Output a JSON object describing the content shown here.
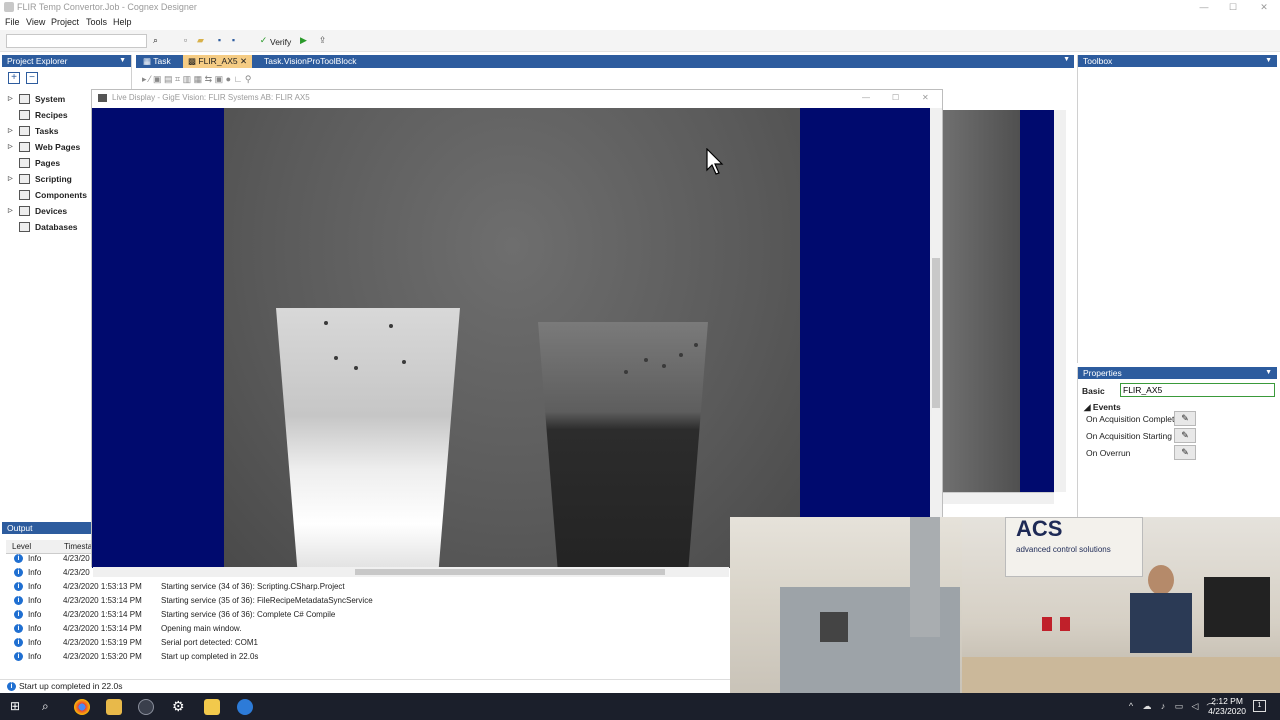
{
  "window": {
    "title": "FLIR Temp Convertor.Job - Cognex Designer",
    "min": "—",
    "max": "☐",
    "close": "✕"
  },
  "menu": {
    "items": [
      "File",
      "View",
      "Project",
      "Tools",
      "Help"
    ]
  },
  "toolbar": {
    "verify_label": "Verify",
    "search_value": ""
  },
  "project_explorer": {
    "title": "Project Explorer",
    "items": [
      {
        "label": "System",
        "expandable": true
      },
      {
        "label": "Recipes",
        "expandable": false
      },
      {
        "label": "Tasks",
        "expandable": true
      },
      {
        "label": "Web Pages",
        "expandable": true
      },
      {
        "label": "Pages",
        "expandable": false
      },
      {
        "label": "Scripting",
        "expandable": true
      },
      {
        "label": "Components",
        "expandable": false
      },
      {
        "label": "Devices",
        "expandable": true
      },
      {
        "label": "Databases",
        "expandable": false
      }
    ]
  },
  "doc_tabs": [
    {
      "label": "Task",
      "active": false
    },
    {
      "label": "FLIR_AX5",
      "active": true
    },
    {
      "label": "Task.VisionProToolBlock",
      "active": false
    }
  ],
  "toolbox": {
    "title": "Toolbox"
  },
  "properties": {
    "title": "Properties",
    "basic_label": "Basic",
    "basic_value": "FLIR_AX5",
    "events_label": "Events",
    "events": [
      "On Acquisition Complete",
      "On Acquisition Starting",
      "On Overrun"
    ]
  },
  "live_display": {
    "title": "Live Display - GigE Vision: FLIR Systems AB: FLIR AX5"
  },
  "output": {
    "title": "Output",
    "columns": [
      "Level",
      "Timesta"
    ],
    "rows": [
      {
        "level": "Info",
        "time": "4/23/20",
        "message": ""
      },
      {
        "level": "Info",
        "time": "4/23/20",
        "message": ""
      },
      {
        "level": "Info",
        "time": "4/23/2020 1:53:13 PM",
        "message": "Starting service (34 of 36): Scripting.CSharp.Project"
      },
      {
        "level": "Info",
        "time": "4/23/2020 1:53:14 PM",
        "message": "Starting service (35 of 36): FileRecipeMetadataSyncService"
      },
      {
        "level": "Info",
        "time": "4/23/2020 1:53:14 PM",
        "message": "Starting service (36 of 36): Complete C# Compile"
      },
      {
        "level": "Info",
        "time": "4/23/2020 1:53:14 PM",
        "message": "Opening main window."
      },
      {
        "level": "Info",
        "time": "4/23/2020 1:53:19 PM",
        "message": "Serial port detected: COM1"
      },
      {
        "level": "Info",
        "time": "4/23/2020 1:53:20 PM",
        "message": "Start up completed in 22.0s"
      }
    ]
  },
  "status": {
    "text": "Start up completed in 22.0s"
  },
  "webcam": {
    "sign_title": "ACS",
    "sign_subtitle": "advanced control solutions"
  },
  "taskbar": {
    "time": "2:12 PM",
    "date": "4/23/2020",
    "notif_count": "1"
  }
}
